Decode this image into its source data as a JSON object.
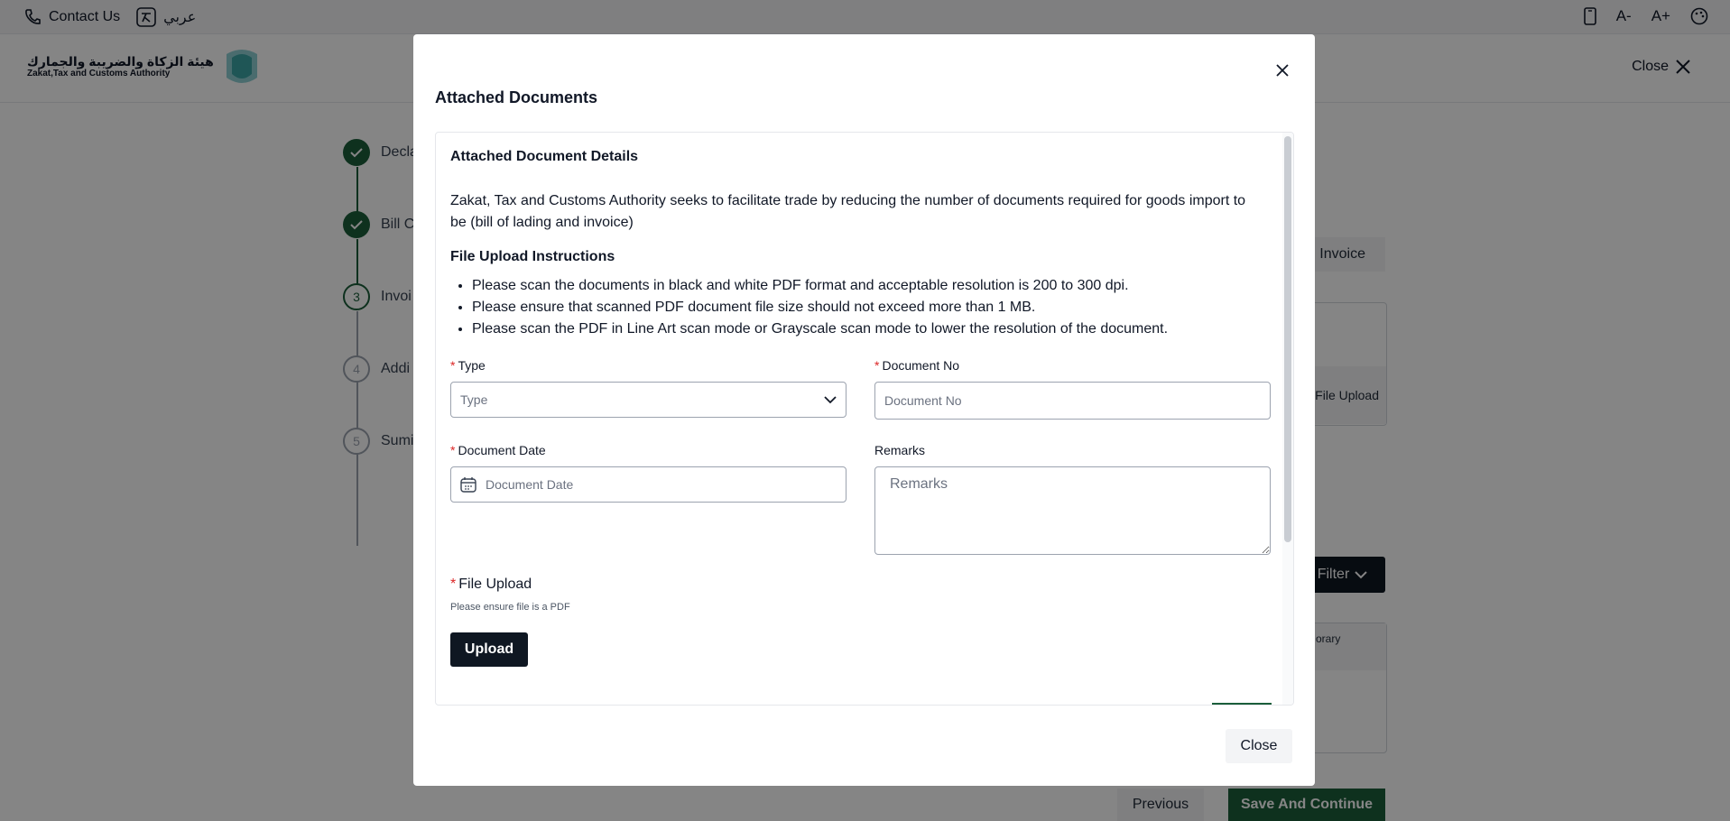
{
  "topbar": {
    "contact_label": "Contact Us",
    "lang_label": "عربي",
    "icons": [
      "phone-icon",
      "language-icon",
      "device-icon",
      "font-decrease-icon",
      "font-increase-icon",
      "palette-icon"
    ],
    "font_decrease": "A-",
    "font_increase": "A+"
  },
  "header": {
    "logo_arabic": "هيئة الزكاة والضريبة والجمارك",
    "logo_english": "Zakat,Tax and Customs Authority",
    "close_label": "Close"
  },
  "stepper": {
    "steps": [
      {
        "number": "",
        "label": "Decla",
        "state": "done"
      },
      {
        "number": "",
        "label": "Bill C",
        "state": "done"
      },
      {
        "number": "3",
        "label": "Invoi",
        "state": "active"
      },
      {
        "number": "4",
        "label": "Addi",
        "state": "todo"
      },
      {
        "number": "5",
        "label": "Sumi",
        "state": "todo"
      }
    ]
  },
  "background": {
    "invoice_tab": "Invoice",
    "file_upload_col": "File Upload",
    "filter_label": "Filter",
    "temporary_col": "orary",
    "previous_label": "Previous",
    "save_label": "Save And Continue"
  },
  "modal": {
    "title": "Attached Documents",
    "section_title": "Attached Document Details",
    "intro": "Zakat, Tax and Customs Authority seeks to facilitate trade by reducing the number of documents required for goods import to be (bill of lading and invoice)",
    "instructions_title": "File Upload Instructions",
    "instructions": [
      "Please scan the documents in black and white PDF format and acceptable resolution is 200 to 300 dpi.",
      "Please ensure that scanned PDF document file size should not exceed more than 1 MB.",
      "Please scan the PDF in Line Art scan mode or Grayscale scan mode to lower the resolution of the document."
    ],
    "type_label": "Type",
    "type_value": "Type",
    "doc_no_label": "Document No",
    "doc_no_placeholder": "Document No",
    "doc_date_label": "Document Date",
    "doc_date_placeholder": "Document Date",
    "remarks_label": "Remarks",
    "remarks_placeholder": "Remarks",
    "file_upload_label": "File Upload",
    "file_hint": "Please ensure file is a PDF",
    "upload_label": "Upload",
    "close_label": "Close",
    "required_mark": "*"
  },
  "colors": {
    "brand_green": "#1b5e3b",
    "dark_button": "#0f1722",
    "required_red": "#dc2626"
  }
}
